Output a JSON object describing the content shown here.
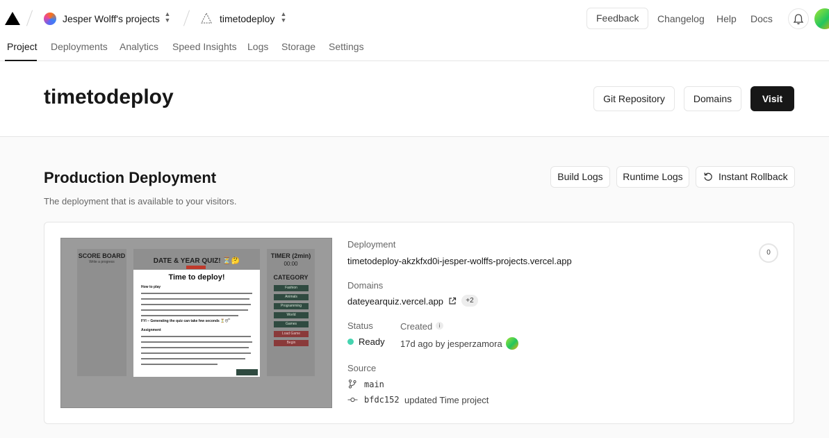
{
  "header": {
    "team_name": "Jesper Wolff's projects",
    "project_name": "timetodeploy",
    "feedback_label": "Feedback",
    "links": [
      "Changelog",
      "Help",
      "Docs"
    ]
  },
  "tabs": [
    "Project",
    "Deployments",
    "Analytics",
    "Speed Insights",
    "Logs",
    "Storage",
    "Settings"
  ],
  "active_tab": "Project",
  "hero": {
    "title": "timetodeploy",
    "buttons": [
      "Git Repository",
      "Domains",
      "Visit"
    ]
  },
  "production": {
    "title": "Production Deployment",
    "subtitle": "The deployment that is available to your visitors.",
    "buttons": [
      "Build Logs",
      "Runtime Logs",
      "Instant Rollback"
    ]
  },
  "deployment": {
    "deployment_label": "Deployment",
    "deployment_url": "timetodeploy-akzkfxd0i-jesper-wolffs-projects.vercel.app",
    "domains_label": "Domains",
    "domain": "dateyearquiz.vercel.app",
    "domain_extra": "+2",
    "status_label": "Status",
    "status": "Ready",
    "created_label": "Created",
    "created": "17d ago by jesperzamora",
    "source_label": "Source",
    "branch": "main",
    "commit_hash": "bfdc152",
    "commit_message": "updated Time project",
    "counter": "0"
  },
  "preview": {
    "score_board": "SCORE BOARD",
    "score_sub": "Write a progress",
    "quiz_title": "DATE & YEAR QUIZ! ⏳🤔",
    "timer": "TIMER (2min)",
    "timer_value": "00:00",
    "category": "CATEGORY",
    "categories": [
      "Fashion",
      "Animals",
      "Programming",
      "World",
      "Games",
      "Load Game",
      "Begin"
    ],
    "modal_title": "Time to deploy!",
    "how_to_play": "How to play",
    "fyi": "FYI – Generating the quiz can take few seconds ⏳😴",
    "assignment": "Assignment"
  },
  "colors": {
    "status_ready": "#45d4b0",
    "primary_button": "#171717"
  }
}
